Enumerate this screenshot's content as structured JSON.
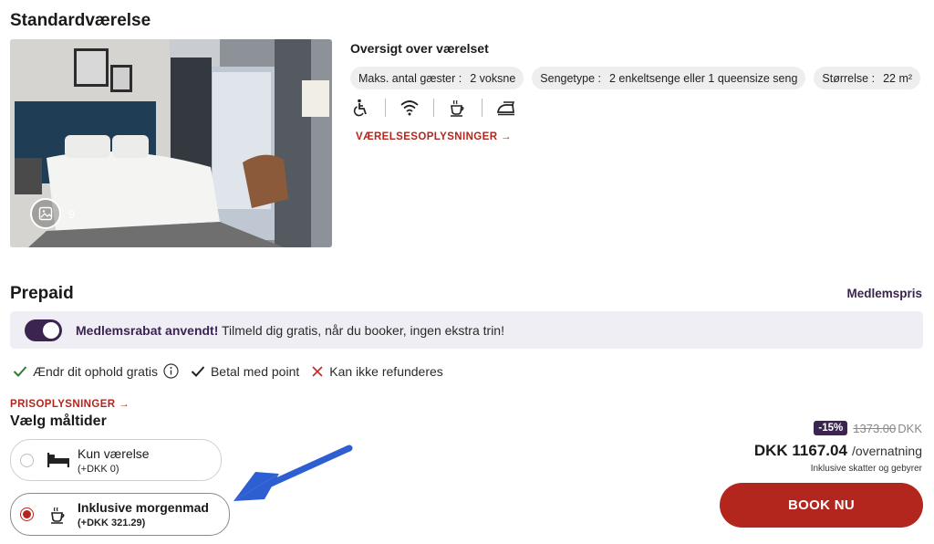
{
  "room": {
    "title": "Standardværelse",
    "photo_count": "9",
    "overview_title": "Oversigt over værelset",
    "chips": [
      {
        "label": "Maks. antal gæster :",
        "value": "2 voksne"
      },
      {
        "label": "Sengetype :",
        "value": "2 enkeltsenge eller 1 queensize seng"
      },
      {
        "label": "Størrelse :",
        "value": "22 m²"
      }
    ],
    "amenity_icons": [
      "wheelchair-icon",
      "wifi-icon",
      "coffee-icon",
      "iron-icon"
    ],
    "info_link": "VÆRELSESOPLYSNINGER →"
  },
  "rate": {
    "title": "Prepaid",
    "member_price_label": "Medlemspris",
    "member_bar": {
      "bold": "Medlemsrabat anvendt!",
      "text": " Tilmeld dig gratis, når du booker, ingen ekstra trin!",
      "toggle_on": true
    },
    "features": [
      {
        "icon": "check-icon",
        "text": "Ændr dit ophold gratis",
        "has_info": true
      },
      {
        "icon": "check-icon",
        "text": "Betal med point",
        "has_info": false
      },
      {
        "icon": "cross-icon",
        "text": "Kan ikke refunderes",
        "has_info": false
      }
    ],
    "price_info_link": "PRISOPLYSNINGER →",
    "meal_title": "Vælg måltider",
    "meals": [
      {
        "name": "Kun værelse",
        "price": "(+DKK 0)",
        "icon": "bed-icon",
        "selected": false
      },
      {
        "name": "Inklusive morgenmad",
        "price": "(+DKK 321.29)",
        "icon": "coffee-icon",
        "selected": true
      }
    ],
    "discount": "-15%",
    "old_price": "1373.00",
    "old_currency": "DKK",
    "price": "DKK 1167.04",
    "per_night": "/overnatning",
    "tax_note": "Inklusive skatter og gebyrer",
    "book_label": "BOOK NU"
  },
  "colors": {
    "accent_red": "#b3261e",
    "brand_purple": "#3b2450",
    "annotation_arrow": "#2d5fd3"
  }
}
